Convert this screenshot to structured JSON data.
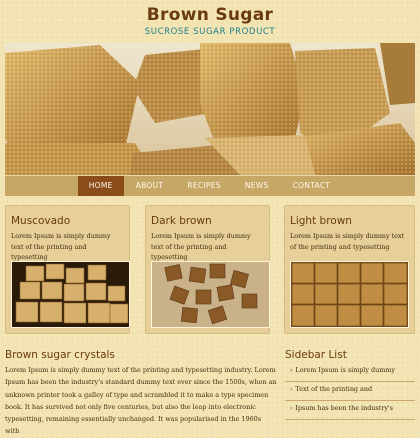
{
  "header": {
    "title": "Brown Sugar",
    "subtitle": "SUCROSE SUGAR PRODUCT"
  },
  "nav": {
    "items": [
      "HOME",
      "ABOUT",
      "RECIPES",
      "NEWS",
      "CONTACT"
    ],
    "active": "HOME"
  },
  "boxes": [
    {
      "title": "Muscovado",
      "text": "Lorem Ipsum is simply dummy text of the printing and typesetting"
    },
    {
      "title": "Dark brown",
      "text": "Lorem Ipsum is simply dummy text of the printing and typesetting"
    },
    {
      "title": "Light brown",
      "text": "Lorem Ipsum is simply dummy text of the printing and typesetting"
    }
  ],
  "main": {
    "title": "Brown sugar crystals",
    "text": "Lorem Ipsum is simply dummy text of the printing and typesetting industry. Lorem Ipsum has been the industry's standard dummy text ever since the 1500s, when an unknown printer took a galley of type and scrambled it to make a type specimen book. It has survived not only five centuries, but also the leap into electronic typesetting, remaining essentially unchanged. It was popularised in the 1960s with"
  },
  "sidebar": {
    "title": "Sidebar List",
    "items": [
      "Lorem Ipsum is simply dummy",
      "Text of the printing and",
      "Ipsum has been the industry's"
    ]
  },
  "colors": {
    "accent": "#6a3a10",
    "subtitle": "#1e7f88",
    "nav": "#c7a766",
    "nav_active": "#8a4d1a"
  }
}
